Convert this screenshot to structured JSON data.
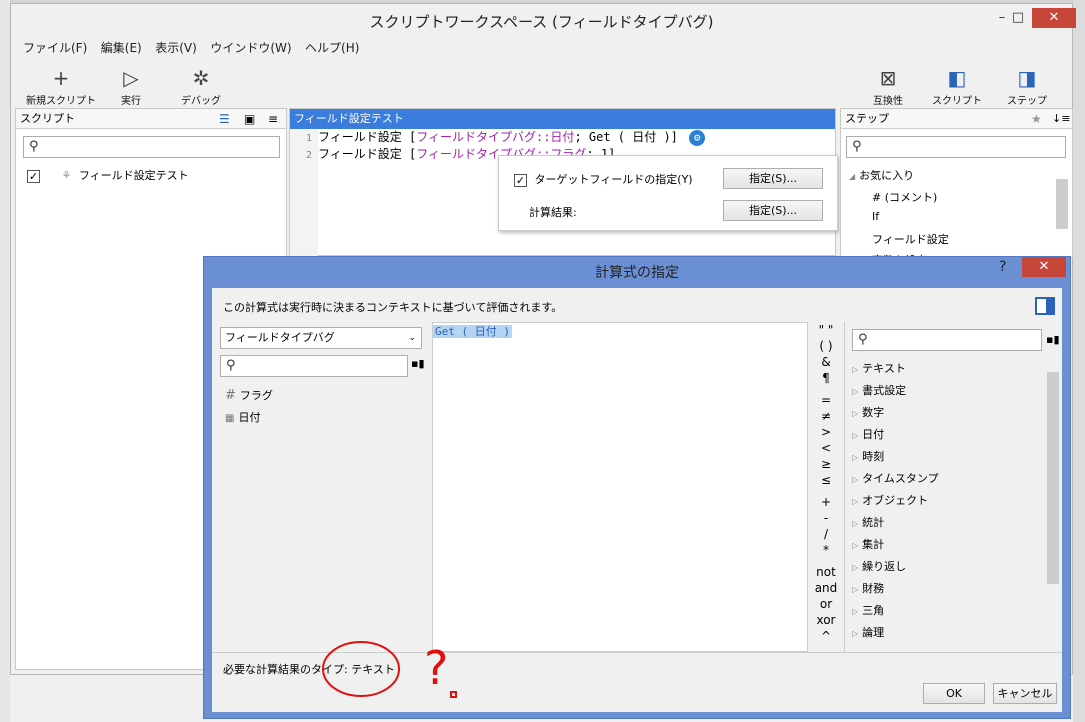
{
  "window": {
    "title": "スクリプトワークスペース (フィールドタイプバグ)",
    "min": "–",
    "max": "□",
    "close": "✕"
  },
  "menu": [
    "ファイル(F)",
    "編集(E)",
    "表示(V)",
    "ウインドウ(W)",
    "ヘルプ(H)"
  ],
  "toolbar": {
    "new_script": "新規スクリプト",
    "run": "実行",
    "debug": "デバッグ",
    "compat": "互換性",
    "scripts": "スクリプト",
    "steps": "ステップ"
  },
  "left_pane": {
    "title": "スクリプト",
    "script_name": "フィールド設定テスト"
  },
  "mid_pane": {
    "title": "フィールド設定テスト",
    "lines": [
      {
        "num": "1",
        "a": "フィールド設定 [",
        "b": "フィールドタイプバグ::日付",
        "c": "; Get ( 日付 )]"
      },
      {
        "num": "2",
        "a": "フィールド設定 [",
        "b": "フィールドタイプバグ::フラグ",
        "c": "; 1]"
      }
    ]
  },
  "popover": {
    "target_label": "ターゲットフィールドの指定(Y)",
    "target_button": "指定(S)...",
    "calc_label": "計算結果:",
    "calc_button": "指定(S)..."
  },
  "right_pane": {
    "title": "ステップ",
    "favorites": "お気に入り",
    "items": [
      "# (コメント)",
      "If",
      "フィールド設定",
      "変数を設定"
    ]
  },
  "dialog": {
    "title": "計算式の指定",
    "help": "?",
    "close": "✕",
    "context_note": "この計算式は実行時に決まるコンテキストに基づいて評価されます。",
    "table_select": "フィールドタイプバグ",
    "fields": [
      {
        "icon": "#",
        "name": "フラグ"
      },
      {
        "icon": "📅",
        "name": "日付"
      }
    ],
    "formula": "Get ( 日付 )",
    "operators": [
      "\" \"",
      "( )",
      "&",
      "¶",
      "=",
      "≠",
      ">",
      "<",
      "≥",
      "≤",
      "+",
      "-",
      "/",
      "*",
      "not",
      "and",
      "or",
      "xor",
      "^"
    ],
    "functions": [
      "テキスト",
      "書式設定",
      "数字",
      "日付",
      "時刻",
      "タイムスタンプ",
      "オブジェクト",
      "統計",
      "集計",
      "繰り返し",
      "財務",
      "三角",
      "論理"
    ],
    "result_type": "必要な計算結果のタイプ: テキスト",
    "ok": "OK",
    "cancel": "キャンセル"
  },
  "annotation": {
    "mark": "?"
  },
  "colors": {
    "accent": "#2a63b8",
    "pane_head_selected": "#3b7ddd",
    "dialog_border": "#6b8fd3",
    "close_red": "#c7463a",
    "annotation_red": "#e01010"
  }
}
